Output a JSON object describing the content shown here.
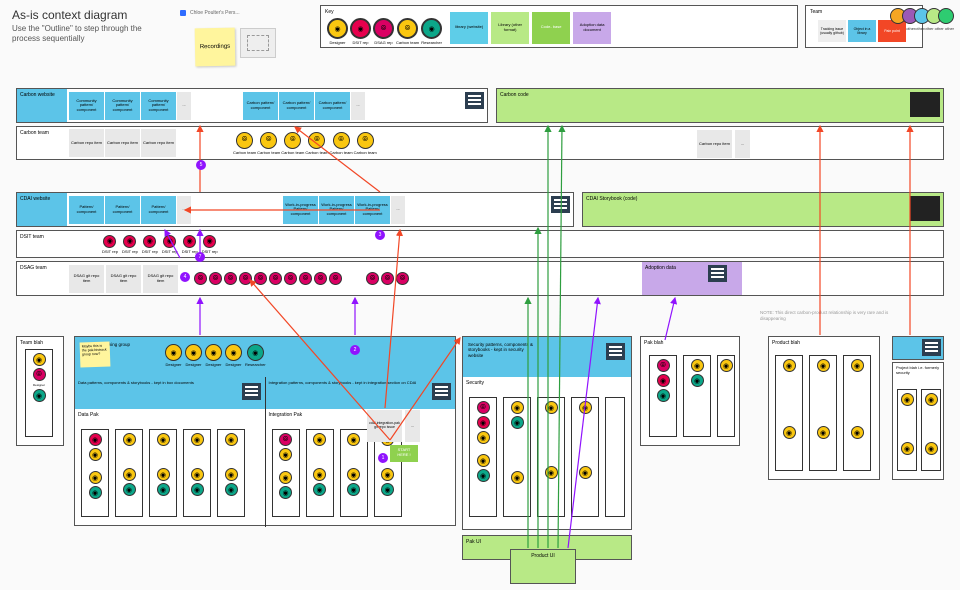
{
  "title": "As-is context diagram",
  "subtitle": "Use the \"Outline\" to step through the process sequentially",
  "recordings": "Recordings",
  "dot_text": "Chloe Poulter's Pers...",
  "key": {
    "label": "Key",
    "roles": [
      {
        "name": "Designer",
        "cls": "designer",
        "g": "◉"
      },
      {
        "name": "DSIT rep",
        "cls": "dsit",
        "g": "◉"
      },
      {
        "name": "DSAG rep",
        "cls": "dsag",
        "g": "⦾"
      },
      {
        "name": "Carbon team",
        "cls": "carbon",
        "g": "⦾"
      },
      {
        "name": "Researcher",
        "cls": "researcher",
        "g": "◉"
      }
    ],
    "boxes": [
      {
        "label": "library (website)",
        "cls": "lib-web"
      },
      {
        "label": "Library (other format)",
        "cls": "lib-other"
      },
      {
        "label": "Code- base",
        "cls": "codebase"
      },
      {
        "label": "Adoption data document",
        "cls": "adoption"
      }
    ]
  },
  "teambox": {
    "label": "Team",
    "items": [
      "Tracking issue (usually github)",
      "Object in a library",
      "Pain point"
    ]
  },
  "corner": [
    "other",
    "other",
    "other",
    "other",
    "other"
  ],
  "rows": {
    "carbon_website": {
      "title": "Carbon website",
      "cards": [
        "Community pattern/ component",
        "Community pattern/ component",
        "Community pattern/ component",
        "...",
        "",
        "Carbon pattern/ component",
        "Carbon pattern/ component",
        "Carbon pattern/ component",
        "..."
      ]
    },
    "carbon_code": {
      "title": "Carbon code"
    },
    "carbon_team": {
      "title": "Carbon team",
      "cards": [
        "Carbon repo item",
        "Carbon repo item",
        "Carbon repo item"
      ],
      "right_card": "Carbon repo item"
    },
    "cdai_website": {
      "title": "CDAI website",
      "cards": [
        "Pattern/ component",
        "Pattern/ component",
        "Pattern/ component",
        "...",
        "",
        "Work-in-progress Pattern/ component",
        "Work-in-progress Pattern/ component",
        "Work-in-progress Pattern/ component",
        "..."
      ]
    },
    "cdai_storybook": {
      "title": "CDAI Storybook (code)"
    },
    "dsit_team": {
      "title": "DSIT team"
    },
    "dsag_team": {
      "title": "DSAG team",
      "cards": [
        "DSAG git repo item",
        "DSAG git repo item",
        "DSAG git repo item"
      ]
    },
    "adoption": {
      "title": "Adoption data"
    },
    "note": "NOTE: This direct carbon-product relationship is very rare and is disappearing",
    "team_blah": "Team blah",
    "crosspak": {
      "title": "Cross-pak working group"
    },
    "data_patterns": "Data patterns, components & storybooks - kept in box documents",
    "integration_patterns": "Integration patterns, components & storybooks - kept in integration section on CDAI",
    "security_patterns": "Security patterns, components & storybooks - kept in security website",
    "data_pak": "Data Pak",
    "integration_pak": "Integration Pak",
    "security": "Security",
    "pak_blah": "Pak blah",
    "pak_ui": "Pak UI",
    "product_blah": "Product blah",
    "project_blah": "Project blah i.e. formerly security",
    "product_ui": "Product UI",
    "cdai_issue": "cdai-integration-pak git repo issue",
    "start": "START HERE !",
    "maybe": "Maybe this is the pak-bistrack group now?"
  }
}
